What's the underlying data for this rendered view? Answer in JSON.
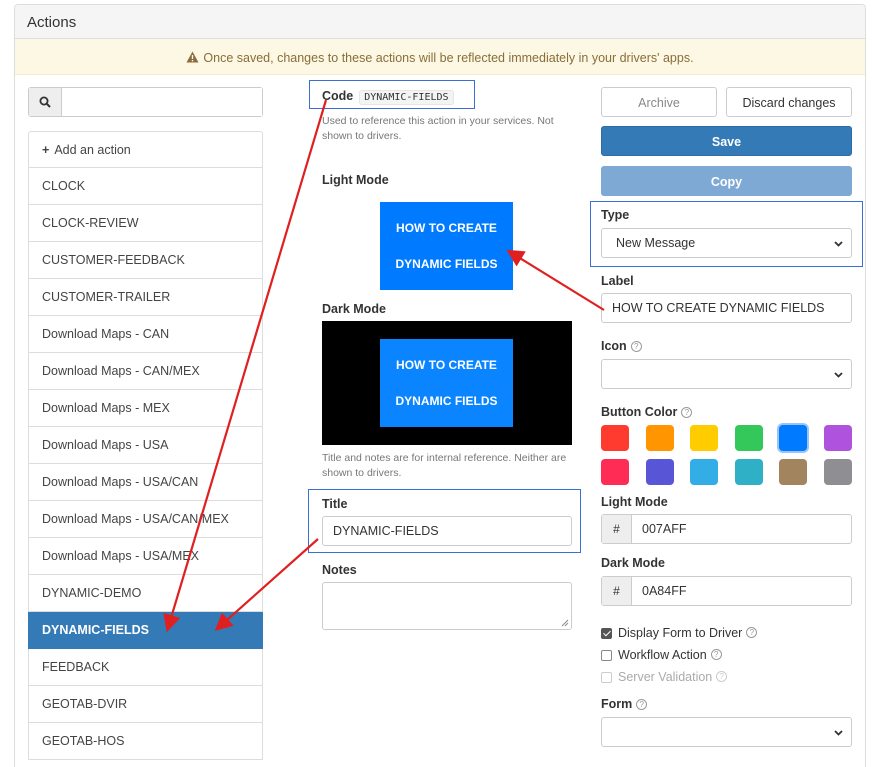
{
  "panel": {
    "title": "Actions"
  },
  "alert": {
    "text": "Once saved, changes to these actions will be reflected immediately in your drivers' apps."
  },
  "search": {
    "placeholder": ""
  },
  "actions_list": {
    "add_label": "Add an action",
    "items": [
      "CLOCK",
      "CLOCK-REVIEW",
      "CUSTOMER-FEEDBACK",
      "CUSTOMER-TRAILER",
      "Download Maps - CAN",
      "Download Maps - CAN/MEX",
      "Download Maps - MEX",
      "Download Maps - USA",
      "Download Maps - USA/CAN",
      "Download Maps - USA/CAN/MEX",
      "Download Maps - USA/MEX",
      "DYNAMIC-DEMO",
      "DYNAMIC-FIELDS",
      "FEEDBACK",
      "GEOTAB-DVIR",
      "GEOTAB-HOS"
    ],
    "active_index": 12
  },
  "editor": {
    "code_label": "Code",
    "code_value": "DYNAMIC-FIELDS",
    "code_help_1": "Used to reference this action in your services. Not",
    "code_help_2": "shown to drivers.",
    "light_mode_label": "Light Mode",
    "dark_mode_label": "Dark Mode",
    "preview_line_1": "HOW TO CREATE",
    "preview_line_2": "DYNAMIC FIELDS",
    "notes_help_1": "Title and notes are for internal reference. Neither are",
    "notes_help_2": "shown to drivers.",
    "title_label": "Title",
    "title_value": "DYNAMIC-FIELDS",
    "notes_label": "Notes",
    "notes_value": ""
  },
  "sidebar": {
    "archive_label": "Archive",
    "discard_label": "Discard changes",
    "save_label": "Save",
    "copy_label": "Copy",
    "type_label": "Type",
    "type_value": "New Message",
    "label_label": "Label",
    "label_value": "HOW TO CREATE DYNAMIC FIELDS",
    "icon_label": "Icon",
    "icon_value": "",
    "button_color_label": "Button Color",
    "colors_row_1": [
      "#FF3B30",
      "#FF9500",
      "#FFCC00",
      "#34C759",
      "#007AFF",
      "#AF52DE"
    ],
    "colors_row_2": [
      "#FF2D55",
      "#5856D6",
      "#32ADE6",
      "#30B0C7",
      "#A2845E",
      "#8E8E93"
    ],
    "selected_color": "#007AFF",
    "light_mode_label": "Light Mode",
    "light_hex": "007AFF",
    "dark_mode_label": "Dark Mode",
    "dark_hex": "0A84FF",
    "hash": "#",
    "display_form_label": "Display Form to Driver",
    "display_form_checked": true,
    "workflow_label": "Workflow Action",
    "workflow_checked": false,
    "server_validation_label": "Server Validation",
    "server_validation_checked": false,
    "form_label": "Form",
    "form_value": ""
  },
  "colors": {
    "primary": "#337ab7",
    "preview_light": "#007AFF",
    "preview_dark": "#0A84FF",
    "annotation_red": "#e02020",
    "annotation_blue": "#3a6fd8"
  }
}
